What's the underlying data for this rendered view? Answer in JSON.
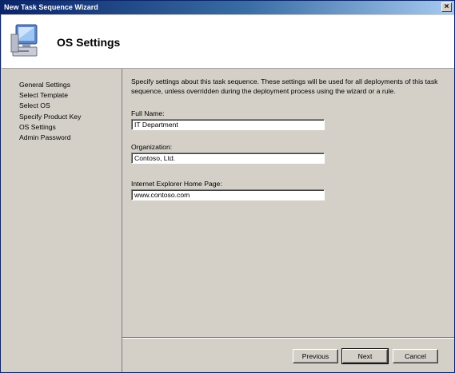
{
  "window": {
    "title": "New Task Sequence Wizard",
    "close_glyph": "×"
  },
  "header": {
    "title": "OS Settings",
    "icon": "computer-icon"
  },
  "nav": {
    "items": [
      "General Settings",
      "Select Template",
      "Select OS",
      "Specify Product Key",
      "OS Settings",
      "Admin Password"
    ]
  },
  "main": {
    "description": "Specify settings about this task sequence.  These settings will be used for all deployments of this task sequence, unless overridden during the deployment process using the wizard or a rule.",
    "full_name_label": "Full Name:",
    "full_name_value": "IT Department",
    "organization_label": "Organization:",
    "organization_value": "Contoso, Ltd.",
    "homepage_label": "Internet Explorer Home Page:",
    "homepage_value": "www.contoso.com"
  },
  "buttons": {
    "previous": "Previous",
    "next": "Next",
    "cancel": "Cancel"
  }
}
